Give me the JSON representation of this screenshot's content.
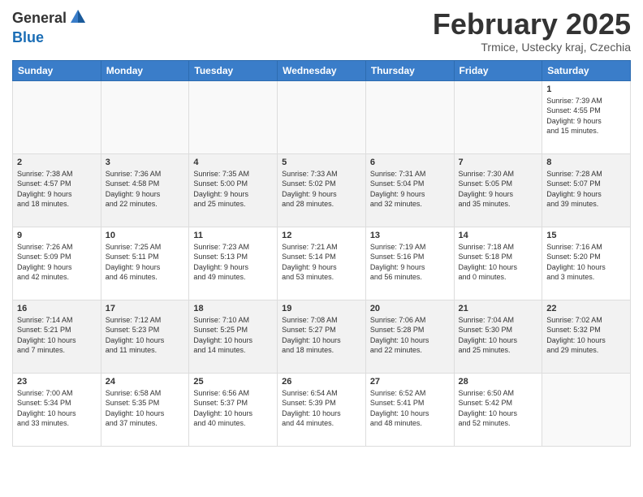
{
  "header": {
    "logo_general": "General",
    "logo_blue": "Blue",
    "month_title": "February 2025",
    "location": "Trmice, Ustecky kraj, Czechia"
  },
  "weekdays": [
    "Sunday",
    "Monday",
    "Tuesday",
    "Wednesday",
    "Thursday",
    "Friday",
    "Saturday"
  ],
  "weeks": [
    {
      "shaded": false,
      "days": [
        {
          "num": "",
          "info": ""
        },
        {
          "num": "",
          "info": ""
        },
        {
          "num": "",
          "info": ""
        },
        {
          "num": "",
          "info": ""
        },
        {
          "num": "",
          "info": ""
        },
        {
          "num": "",
          "info": ""
        },
        {
          "num": "1",
          "info": "Sunrise: 7:39 AM\nSunset: 4:55 PM\nDaylight: 9 hours\nand 15 minutes."
        }
      ]
    },
    {
      "shaded": true,
      "days": [
        {
          "num": "2",
          "info": "Sunrise: 7:38 AM\nSunset: 4:57 PM\nDaylight: 9 hours\nand 18 minutes."
        },
        {
          "num": "3",
          "info": "Sunrise: 7:36 AM\nSunset: 4:58 PM\nDaylight: 9 hours\nand 22 minutes."
        },
        {
          "num": "4",
          "info": "Sunrise: 7:35 AM\nSunset: 5:00 PM\nDaylight: 9 hours\nand 25 minutes."
        },
        {
          "num": "5",
          "info": "Sunrise: 7:33 AM\nSunset: 5:02 PM\nDaylight: 9 hours\nand 28 minutes."
        },
        {
          "num": "6",
          "info": "Sunrise: 7:31 AM\nSunset: 5:04 PM\nDaylight: 9 hours\nand 32 minutes."
        },
        {
          "num": "7",
          "info": "Sunrise: 7:30 AM\nSunset: 5:05 PM\nDaylight: 9 hours\nand 35 minutes."
        },
        {
          "num": "8",
          "info": "Sunrise: 7:28 AM\nSunset: 5:07 PM\nDaylight: 9 hours\nand 39 minutes."
        }
      ]
    },
    {
      "shaded": false,
      "days": [
        {
          "num": "9",
          "info": "Sunrise: 7:26 AM\nSunset: 5:09 PM\nDaylight: 9 hours\nand 42 minutes."
        },
        {
          "num": "10",
          "info": "Sunrise: 7:25 AM\nSunset: 5:11 PM\nDaylight: 9 hours\nand 46 minutes."
        },
        {
          "num": "11",
          "info": "Sunrise: 7:23 AM\nSunset: 5:13 PM\nDaylight: 9 hours\nand 49 minutes."
        },
        {
          "num": "12",
          "info": "Sunrise: 7:21 AM\nSunset: 5:14 PM\nDaylight: 9 hours\nand 53 minutes."
        },
        {
          "num": "13",
          "info": "Sunrise: 7:19 AM\nSunset: 5:16 PM\nDaylight: 9 hours\nand 56 minutes."
        },
        {
          "num": "14",
          "info": "Sunrise: 7:18 AM\nSunset: 5:18 PM\nDaylight: 10 hours\nand 0 minutes."
        },
        {
          "num": "15",
          "info": "Sunrise: 7:16 AM\nSunset: 5:20 PM\nDaylight: 10 hours\nand 3 minutes."
        }
      ]
    },
    {
      "shaded": true,
      "days": [
        {
          "num": "16",
          "info": "Sunrise: 7:14 AM\nSunset: 5:21 PM\nDaylight: 10 hours\nand 7 minutes."
        },
        {
          "num": "17",
          "info": "Sunrise: 7:12 AM\nSunset: 5:23 PM\nDaylight: 10 hours\nand 11 minutes."
        },
        {
          "num": "18",
          "info": "Sunrise: 7:10 AM\nSunset: 5:25 PM\nDaylight: 10 hours\nand 14 minutes."
        },
        {
          "num": "19",
          "info": "Sunrise: 7:08 AM\nSunset: 5:27 PM\nDaylight: 10 hours\nand 18 minutes."
        },
        {
          "num": "20",
          "info": "Sunrise: 7:06 AM\nSunset: 5:28 PM\nDaylight: 10 hours\nand 22 minutes."
        },
        {
          "num": "21",
          "info": "Sunrise: 7:04 AM\nSunset: 5:30 PM\nDaylight: 10 hours\nand 25 minutes."
        },
        {
          "num": "22",
          "info": "Sunrise: 7:02 AM\nSunset: 5:32 PM\nDaylight: 10 hours\nand 29 minutes."
        }
      ]
    },
    {
      "shaded": false,
      "days": [
        {
          "num": "23",
          "info": "Sunrise: 7:00 AM\nSunset: 5:34 PM\nDaylight: 10 hours\nand 33 minutes."
        },
        {
          "num": "24",
          "info": "Sunrise: 6:58 AM\nSunset: 5:35 PM\nDaylight: 10 hours\nand 37 minutes."
        },
        {
          "num": "25",
          "info": "Sunrise: 6:56 AM\nSunset: 5:37 PM\nDaylight: 10 hours\nand 40 minutes."
        },
        {
          "num": "26",
          "info": "Sunrise: 6:54 AM\nSunset: 5:39 PM\nDaylight: 10 hours\nand 44 minutes."
        },
        {
          "num": "27",
          "info": "Sunrise: 6:52 AM\nSunset: 5:41 PM\nDaylight: 10 hours\nand 48 minutes."
        },
        {
          "num": "28",
          "info": "Sunrise: 6:50 AM\nSunset: 5:42 PM\nDaylight: 10 hours\nand 52 minutes."
        },
        {
          "num": "",
          "info": ""
        }
      ]
    }
  ]
}
